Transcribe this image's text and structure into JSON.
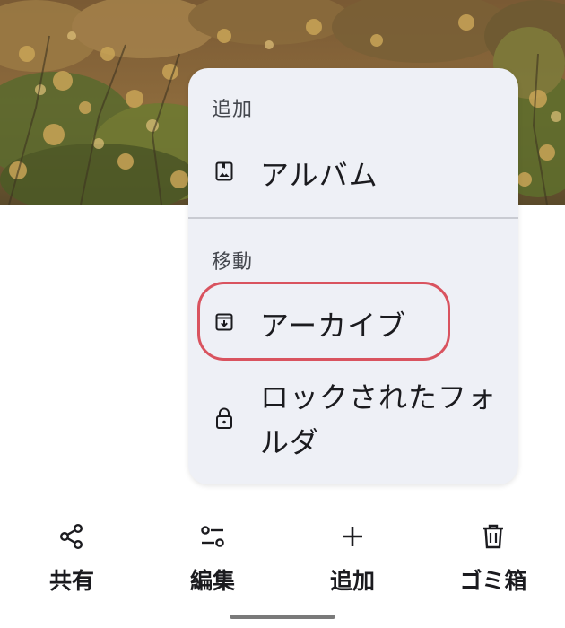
{
  "menu": {
    "sections": [
      {
        "header": "追加",
        "items": [
          {
            "label": "アルバム",
            "icon": "album-icon"
          }
        ]
      },
      {
        "header": "移動",
        "items": [
          {
            "label": "アーカイブ",
            "icon": "archive-icon",
            "highlighted": true
          },
          {
            "label_line1": "ロックされたフォ",
            "label_line2": "ルダ",
            "icon": "lock-icon"
          }
        ]
      }
    ]
  },
  "action_bar": {
    "items": [
      {
        "label": "共有",
        "icon": "share-icon"
      },
      {
        "label": "編集",
        "icon": "edit-icon"
      },
      {
        "label": "追加",
        "icon": "add-icon"
      },
      {
        "label": "ゴミ箱",
        "icon": "trash-icon"
      }
    ]
  },
  "colors": {
    "menu_bg": "#eef0f6",
    "highlight_ring": "#d9535f",
    "text": "#1b1b1f"
  }
}
